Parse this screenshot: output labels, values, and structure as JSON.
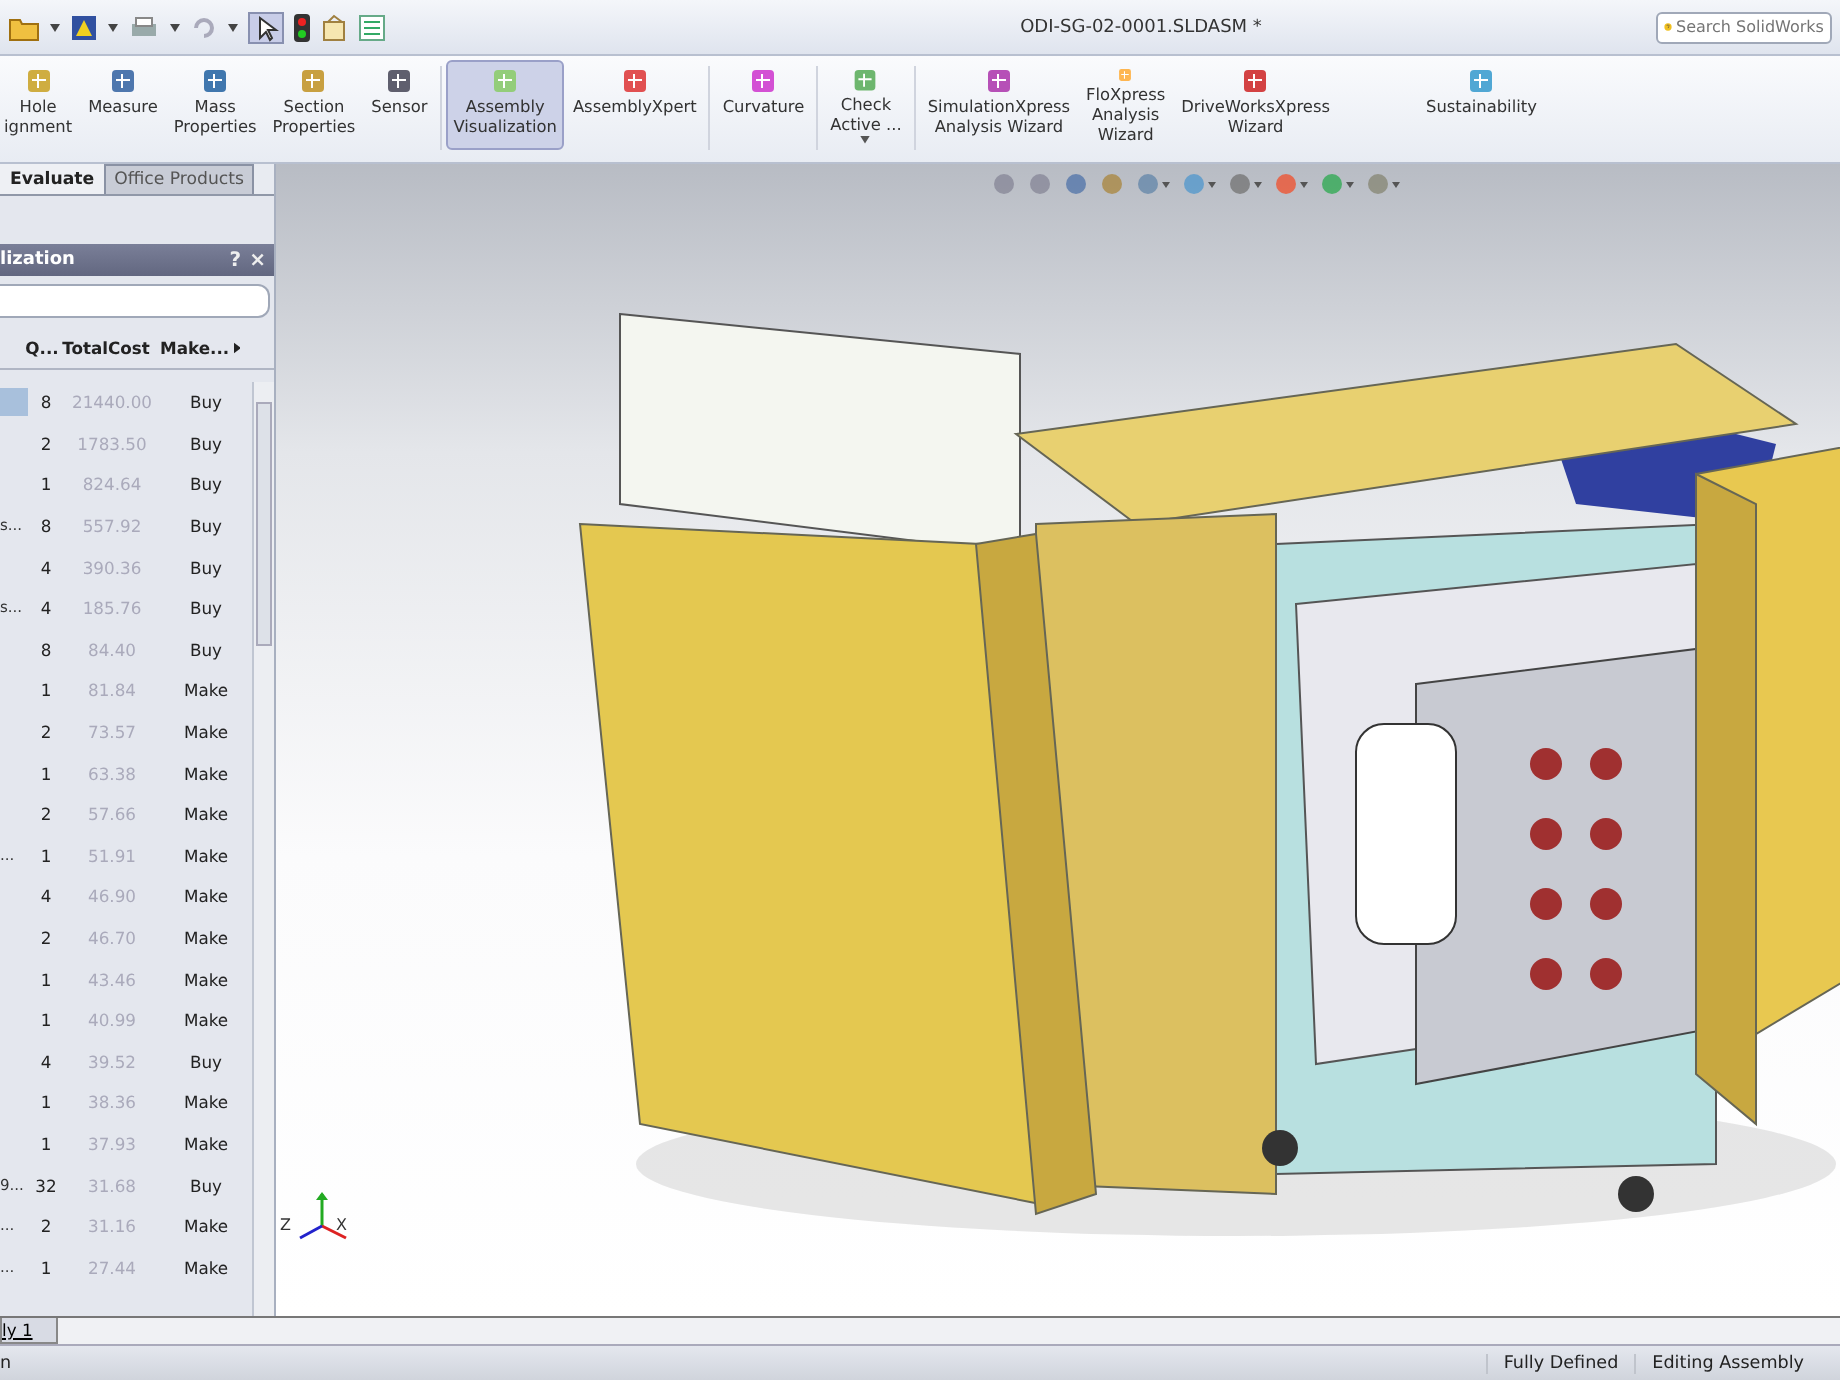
{
  "title_bar": {
    "document_title": "ODI-SG-02-0001.SLDASM *",
    "search": {
      "placeholder": "Search SolidWorks"
    }
  },
  "ribbon": {
    "buttons": [
      {
        "lines": [
          "Hole",
          "ignment"
        ],
        "selected": false,
        "dropdown": false
      },
      {
        "lines": [
          "Measure"
        ],
        "selected": false,
        "dropdown": false
      },
      {
        "lines": [
          "Mass",
          "Properties"
        ],
        "selected": false,
        "dropdown": false
      },
      {
        "lines": [
          "Section",
          "Properties"
        ],
        "selected": false,
        "dropdown": false
      },
      {
        "lines": [
          "Sensor"
        ],
        "selected": false,
        "dropdown": false
      },
      {
        "lines": [
          "Assembly",
          "Visualization"
        ],
        "selected": true,
        "dropdown": false
      },
      {
        "lines": [
          "AssemblyXpert"
        ],
        "selected": false,
        "dropdown": false
      },
      {
        "lines": [
          "Curvature"
        ],
        "selected": false,
        "dropdown": false
      },
      {
        "lines": [
          "Check",
          "Active ..."
        ],
        "selected": false,
        "dropdown": true
      },
      {
        "lines": [
          "SimulationXpress",
          "Analysis Wizard"
        ],
        "selected": false,
        "dropdown": false
      },
      {
        "lines": [
          "FloXpress",
          "Analysis",
          "Wizard"
        ],
        "selected": false,
        "dropdown": false
      },
      {
        "lines": [
          "DriveWorksXpress",
          "Wizard"
        ],
        "selected": false,
        "dropdown": false
      },
      {
        "lines": [
          "Sustainability"
        ],
        "selected": false,
        "dropdown": false
      }
    ]
  },
  "command_tabs": [
    {
      "label": "Evaluate",
      "selected": true
    },
    {
      "label": "Office Products",
      "selected": false
    }
  ],
  "panel": {
    "title": "lization",
    "help": "?",
    "close": "×",
    "columns": [
      {
        "label": "Q..."
      },
      {
        "label": "TotalCost"
      },
      {
        "label": "Make..."
      }
    ],
    "rows": [
      {
        "name": "",
        "qty": "8",
        "cost": "21440.00",
        "source": "Buy",
        "selected": true
      },
      {
        "name": "",
        "qty": "2",
        "cost": "1783.50",
        "source": "Buy",
        "selected": false
      },
      {
        "name": "",
        "qty": "1",
        "cost": "824.64",
        "source": "Buy",
        "selected": false
      },
      {
        "name": "s...",
        "qty": "8",
        "cost": "557.92",
        "source": "Buy",
        "selected": false
      },
      {
        "name": "",
        "qty": "4",
        "cost": "390.36",
        "source": "Buy",
        "selected": false
      },
      {
        "name": "s...",
        "qty": "4",
        "cost": "185.76",
        "source": "Buy",
        "selected": false
      },
      {
        "name": "",
        "qty": "8",
        "cost": "84.40",
        "source": "Buy",
        "selected": false
      },
      {
        "name": "",
        "qty": "1",
        "cost": "81.84",
        "source": "Make",
        "selected": false
      },
      {
        "name": "",
        "qty": "2",
        "cost": "73.57",
        "source": "Make",
        "selected": false
      },
      {
        "name": "",
        "qty": "1",
        "cost": "63.38",
        "source": "Make",
        "selected": false
      },
      {
        "name": "",
        "qty": "2",
        "cost": "57.66",
        "source": "Make",
        "selected": false
      },
      {
        "name": "...",
        "qty": "1",
        "cost": "51.91",
        "source": "Make",
        "selected": false
      },
      {
        "name": "",
        "qty": "4",
        "cost": "46.90",
        "source": "Make",
        "selected": false
      },
      {
        "name": "",
        "qty": "2",
        "cost": "46.70",
        "source": "Make",
        "selected": false
      },
      {
        "name": "",
        "qty": "1",
        "cost": "43.46",
        "source": "Make",
        "selected": false
      },
      {
        "name": "",
        "qty": "1",
        "cost": "40.99",
        "source": "Make",
        "selected": false
      },
      {
        "name": "",
        "qty": "4",
        "cost": "39.52",
        "source": "Buy",
        "selected": false
      },
      {
        "name": "",
        "qty": "1",
        "cost": "38.36",
        "source": "Make",
        "selected": false
      },
      {
        "name": "",
        "qty": "1",
        "cost": "37.93",
        "source": "Make",
        "selected": false
      },
      {
        "name": "9...",
        "qty": "32",
        "cost": "31.68",
        "source": "Buy",
        "selected": false
      },
      {
        "name": "...",
        "qty": "2",
        "cost": "31.16",
        "source": "Make",
        "selected": false
      },
      {
        "name": "...",
        "qty": "1",
        "cost": "27.44",
        "source": "Make",
        "selected": false
      }
    ]
  },
  "viewport": {
    "triad_labels": [
      "Z",
      "X"
    ]
  },
  "bottom_tabs": [
    {
      "label": "ly 1",
      "selected": true
    }
  ],
  "status_bar": {
    "left": "n",
    "items": [
      "Fully Defined",
      "Editing Assembly"
    ]
  }
}
